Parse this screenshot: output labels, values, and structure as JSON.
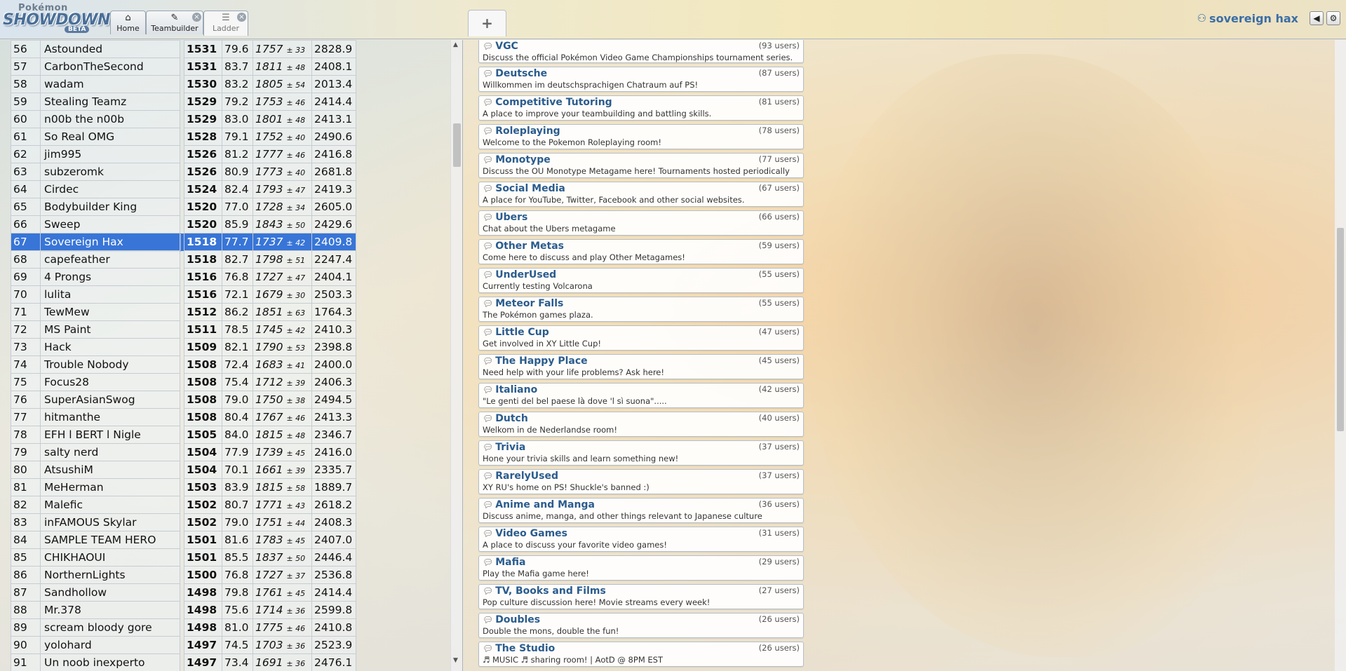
{
  "header": {
    "logo_small": "Pokémon",
    "logo_big": "SHOWDOWN",
    "logo_beta": "BETA",
    "tabs": [
      {
        "label": "Home",
        "icon": "home-icon"
      },
      {
        "label": "Teambuilder",
        "icon": "edit-icon"
      },
      {
        "label": "Ladder",
        "icon": "list-icon"
      }
    ],
    "new_tab_label": "+",
    "username": "sovereign hax",
    "close_glyph": "×"
  },
  "ladder": {
    "rows": [
      {
        "rank": "56",
        "name": "Astounded",
        "elo": "1531",
        "gxe": "79.6",
        "glicko": "1757",
        "dev": "± 33",
        "coil": "2828.9"
      },
      {
        "rank": "57",
        "name": "CarbonTheSecond",
        "elo": "1531",
        "gxe": "83.7",
        "glicko": "1811",
        "dev": "± 48",
        "coil": "2408.1"
      },
      {
        "rank": "58",
        "name": "wadam",
        "elo": "1530",
        "gxe": "83.2",
        "glicko": "1805",
        "dev": "± 54",
        "coil": "2013.4"
      },
      {
        "rank": "59",
        "name": "Stealing Teamz",
        "elo": "1529",
        "gxe": "79.2",
        "glicko": "1753",
        "dev": "± 46",
        "coil": "2414.4"
      },
      {
        "rank": "60",
        "name": "n00b the n00b",
        "elo": "1529",
        "gxe": "83.0",
        "glicko": "1801",
        "dev": "± 48",
        "coil": "2413.1"
      },
      {
        "rank": "61",
        "name": "So Real OMG",
        "elo": "1528",
        "gxe": "79.1",
        "glicko": "1752",
        "dev": "± 40",
        "coil": "2490.6"
      },
      {
        "rank": "62",
        "name": "jim995",
        "elo": "1526",
        "gxe": "81.2",
        "glicko": "1777",
        "dev": "± 46",
        "coil": "2416.8"
      },
      {
        "rank": "63",
        "name": "subzeromk",
        "elo": "1526",
        "gxe": "80.9",
        "glicko": "1773",
        "dev": "± 40",
        "coil": "2681.8"
      },
      {
        "rank": "64",
        "name": "Cirdec",
        "elo": "1524",
        "gxe": "82.4",
        "glicko": "1793",
        "dev": "± 47",
        "coil": "2419.3"
      },
      {
        "rank": "65",
        "name": "Bodybuilder King",
        "elo": "1520",
        "gxe": "77.0",
        "glicko": "1728",
        "dev": "± 34",
        "coil": "2605.0"
      },
      {
        "rank": "66",
        "name": "Sweep",
        "elo": "1520",
        "gxe": "85.9",
        "glicko": "1843",
        "dev": "± 50",
        "coil": "2429.6"
      },
      {
        "rank": "67",
        "name": "Sovereign Hax",
        "elo": "1518",
        "gxe": "77.7",
        "glicko": "1737",
        "dev": "± 42",
        "coil": "2409.8",
        "selected": true
      },
      {
        "rank": "68",
        "name": "capefeather",
        "elo": "1518",
        "gxe": "82.7",
        "glicko": "1798",
        "dev": "± 51",
        "coil": "2247.4"
      },
      {
        "rank": "69",
        "name": "4 Prongs",
        "elo": "1516",
        "gxe": "76.8",
        "glicko": "1727",
        "dev": "± 47",
        "coil": "2404.1"
      },
      {
        "rank": "70",
        "name": "lulita",
        "elo": "1516",
        "gxe": "72.1",
        "glicko": "1679",
        "dev": "± 30",
        "coil": "2503.3"
      },
      {
        "rank": "71",
        "name": "TewMew",
        "elo": "1512",
        "gxe": "86.2",
        "glicko": "1851",
        "dev": "± 63",
        "coil": "1764.3"
      },
      {
        "rank": "72",
        "name": "MS Paint",
        "elo": "1511",
        "gxe": "78.5",
        "glicko": "1745",
        "dev": "± 42",
        "coil": "2410.3"
      },
      {
        "rank": "73",
        "name": "Hack",
        "elo": "1509",
        "gxe": "82.1",
        "glicko": "1790",
        "dev": "± 53",
        "coil": "2398.8"
      },
      {
        "rank": "74",
        "name": "Trouble Nobody",
        "elo": "1508",
        "gxe": "72.4",
        "glicko": "1683",
        "dev": "± 41",
        "coil": "2400.0"
      },
      {
        "rank": "75",
        "name": "Focus28",
        "elo": "1508",
        "gxe": "75.4",
        "glicko": "1712",
        "dev": "± 39",
        "coil": "2406.3"
      },
      {
        "rank": "76",
        "name": "SuperAsianSwog",
        "elo": "1508",
        "gxe": "79.0",
        "glicko": "1750",
        "dev": "± 38",
        "coil": "2494.5"
      },
      {
        "rank": "77",
        "name": "hitmanthe",
        "elo": "1508",
        "gxe": "80.4",
        "glicko": "1767",
        "dev": "± 46",
        "coil": "2413.3"
      },
      {
        "rank": "78",
        "name": "EFH l BERT l Nigle",
        "elo": "1505",
        "gxe": "84.0",
        "glicko": "1815",
        "dev": "± 48",
        "coil": "2346.7"
      },
      {
        "rank": "79",
        "name": "salty nerd",
        "elo": "1504",
        "gxe": "77.9",
        "glicko": "1739",
        "dev": "± 45",
        "coil": "2416.0"
      },
      {
        "rank": "80",
        "name": "AtsushiM",
        "elo": "1504",
        "gxe": "70.1",
        "glicko": "1661",
        "dev": "± 39",
        "coil": "2335.7"
      },
      {
        "rank": "81",
        "name": "MeHerman",
        "elo": "1503",
        "gxe": "83.9",
        "glicko": "1815",
        "dev": "± 58",
        "coil": "1889.7"
      },
      {
        "rank": "82",
        "name": "Malefic",
        "elo": "1502",
        "gxe": "80.7",
        "glicko": "1771",
        "dev": "± 43",
        "coil": "2618.2"
      },
      {
        "rank": "83",
        "name": "inFAMOUS Skylar",
        "elo": "1502",
        "gxe": "79.0",
        "glicko": "1751",
        "dev": "± 44",
        "coil": "2408.3"
      },
      {
        "rank": "84",
        "name": "SAMPLE TEAM HERO",
        "elo": "1501",
        "gxe": "81.6",
        "glicko": "1783",
        "dev": "± 45",
        "coil": "2407.0"
      },
      {
        "rank": "85",
        "name": "CHIKHAOUI",
        "elo": "1501",
        "gxe": "85.5",
        "glicko": "1837",
        "dev": "± 50",
        "coil": "2446.4"
      },
      {
        "rank": "86",
        "name": "NorthernLights",
        "elo": "1500",
        "gxe": "76.8",
        "glicko": "1727",
        "dev": "± 37",
        "coil": "2536.8"
      },
      {
        "rank": "87",
        "name": "Sandhollow",
        "elo": "1498",
        "gxe": "79.8",
        "glicko": "1761",
        "dev": "± 45",
        "coil": "2414.4"
      },
      {
        "rank": "88",
        "name": "Mr.378",
        "elo": "1498",
        "gxe": "75.6",
        "glicko": "1714",
        "dev": "± 36",
        "coil": "2599.8"
      },
      {
        "rank": "89",
        "name": "scream bloody gore",
        "elo": "1498",
        "gxe": "81.0",
        "glicko": "1775",
        "dev": "± 46",
        "coil": "2410.8"
      },
      {
        "rank": "90",
        "name": "yolohard",
        "elo": "1497",
        "gxe": "74.5",
        "glicko": "1703",
        "dev": "± 36",
        "coil": "2523.9"
      },
      {
        "rank": "91",
        "name": "Un noob inexperto",
        "elo": "1497",
        "gxe": "73.4",
        "glicko": "1691",
        "dev": "± 36",
        "coil": "2476.1"
      }
    ]
  },
  "rooms": [
    {
      "name": "VGC",
      "users": "(93 users)",
      "desc": "Discuss the official Pokémon Video Game Championships tournament series."
    },
    {
      "name": "Deutsche",
      "users": "(87 users)",
      "desc": "Willkommen im deutschsprachigen Chatraum auf PS!"
    },
    {
      "name": "Competitive Tutoring",
      "users": "(81 users)",
      "desc": "A place to improve your teambuilding and battling skills."
    },
    {
      "name": "Roleplaying",
      "users": "(78 users)",
      "desc": "Welcome to the Pokemon Roleplaying room!"
    },
    {
      "name": "Monotype",
      "users": "(77 users)",
      "desc": "Discuss the OU Monotype Metagame here! Tournaments hosted periodically"
    },
    {
      "name": "Social Media",
      "users": "(67 users)",
      "desc": "A place for YouTube, Twitter, Facebook and other social websites."
    },
    {
      "name": "Ubers",
      "users": "(66 users)",
      "desc": "Chat about the Ubers metagame"
    },
    {
      "name": "Other Metas",
      "users": "(59 users)",
      "desc": "Come here to discuss and play Other Metagames!"
    },
    {
      "name": "UnderUsed",
      "users": "(55 users)",
      "desc": "Currently testing Volcarona"
    },
    {
      "name": "Meteor Falls",
      "users": "(55 users)",
      "desc": "The Pokémon games plaza."
    },
    {
      "name": "Little Cup",
      "users": "(47 users)",
      "desc": "Get involved in XY Little Cup!"
    },
    {
      "name": "The Happy Place",
      "users": "(45 users)",
      "desc": "Need help with your life problems? Ask here!"
    },
    {
      "name": "Italiano",
      "users": "(42 users)",
      "desc": "\"Le genti del bel paese là dove 'l sì suona\"....."
    },
    {
      "name": "Dutch",
      "users": "(40 users)",
      "desc": "Welkom in de Nederlandse room!"
    },
    {
      "name": "Trivia",
      "users": "(37 users)",
      "desc": "Hone your trivia skills and learn something new!"
    },
    {
      "name": "RarelyUsed",
      "users": "(37 users)",
      "desc": "XY RU's home on PS! Shuckle's banned :)"
    },
    {
      "name": "Anime and Manga",
      "users": "(36 users)",
      "desc": "Discuss anime, manga, and other things relevant to Japanese culture"
    },
    {
      "name": "Video Games",
      "users": "(31 users)",
      "desc": "A place to discuss your favorite video games!"
    },
    {
      "name": "Mafia",
      "users": "(29 users)",
      "desc": "Play the Mafia game here!"
    },
    {
      "name": "TV, Books and Films",
      "users": "(27 users)",
      "desc": "Pop culture discussion here! Movie streams every week!"
    },
    {
      "name": "Doubles",
      "users": "(26 users)",
      "desc": "Double the mons, double the fun!"
    },
    {
      "name": "The Studio",
      "users": "(26 users)",
      "desc": "♬ MUSIC ♬ sharing room! | AotD @ 8PM EST"
    }
  ]
}
